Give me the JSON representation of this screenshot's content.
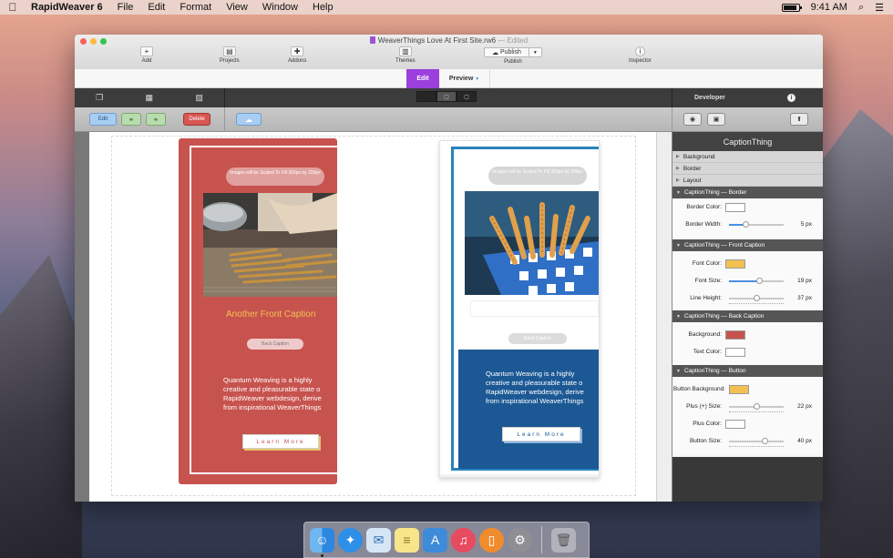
{
  "menubar": {
    "app_name": "RapidWeaver 6",
    "items": [
      "File",
      "Edit",
      "Format",
      "View",
      "Window",
      "Help"
    ],
    "clock": "9:41 AM"
  },
  "window": {
    "doc_title": "WeaverThings Love At First Site.rw6",
    "edited": "— Edited",
    "toolbar": {
      "add": "Add",
      "projects": "Projects",
      "addons": "Addons",
      "themes": "Themes",
      "publish_button": "Publish",
      "publish": "Publish",
      "inspector": "Inspector"
    },
    "modes": {
      "edit": "Edit",
      "preview": "Preview"
    },
    "sidebar_header": "Developer",
    "actions": {
      "edit": "Edit",
      "delete": "Delete"
    }
  },
  "card_front": {
    "image_note": "Images will be Scaled To Fill 300px by 200px",
    "caption": "Another Front Caption",
    "back_caption": "Back Caption",
    "body": [
      "Quantum Weaving is a highly",
      "creative and pleasurable state o",
      "RapidWeaver webdesign, derive",
      "from inspirational WeaverThings"
    ],
    "button": "Learn More"
  },
  "card_back": {
    "image_note": "Images will be Scaled To Fill 300px by 200px",
    "back_caption": "Back Caption",
    "body": [
      "Quantum Weaving is a highly",
      "creative and pleasurable state o",
      "RapidWeaver webdesign, derive",
      "from inspirational WeaverThings"
    ],
    "button": "Learn More"
  },
  "inspector": {
    "title": "CaptionThing",
    "collapsed": [
      "Background",
      "Border",
      "Layout"
    ],
    "border_section": "CaptionThing — Border",
    "border_color_label": "Border Color:",
    "border_width_label": "Border Width:",
    "border_width_value": "5 px",
    "front_section": "CaptionThing — Front Caption",
    "font_color_label": "Font Color:",
    "font_size_label": "Font Size:",
    "font_size_value": "19 px",
    "line_height_label": "Line Height:",
    "line_height_value": "37 px",
    "back_section": "CaptionThing — Back Caption",
    "background_label": "Background:",
    "text_color_label": "Text Color:",
    "button_section": "CaptionThing — Button",
    "button_bg_label": "Button Background:",
    "plus_size_label": "Plus (+) Size:",
    "plus_size_value": "22 px",
    "plus_color_label": "Plus Color:",
    "button_size_label": "Button Size:",
    "button_size_value": "40 px",
    "colors": {
      "border": "#ffffff",
      "font": "#f3c152",
      "back_background": "#c7534e",
      "text": "#ffffff",
      "button_background": "#f3c152",
      "plus": "#ffffff"
    },
    "slider_levels": {
      "border_width": 0.3,
      "font_size": 0.55,
      "line_height": 0.5,
      "plus_size": 0.5,
      "button_size": 0.65
    }
  },
  "dock": {
    "icons": [
      "finder-icon",
      "safari-icon",
      "mail-icon",
      "notes-icon",
      "app-store-icon",
      "itunes-icon",
      "ibooks-icon",
      "system-preferences-icon",
      "trash-icon"
    ]
  }
}
